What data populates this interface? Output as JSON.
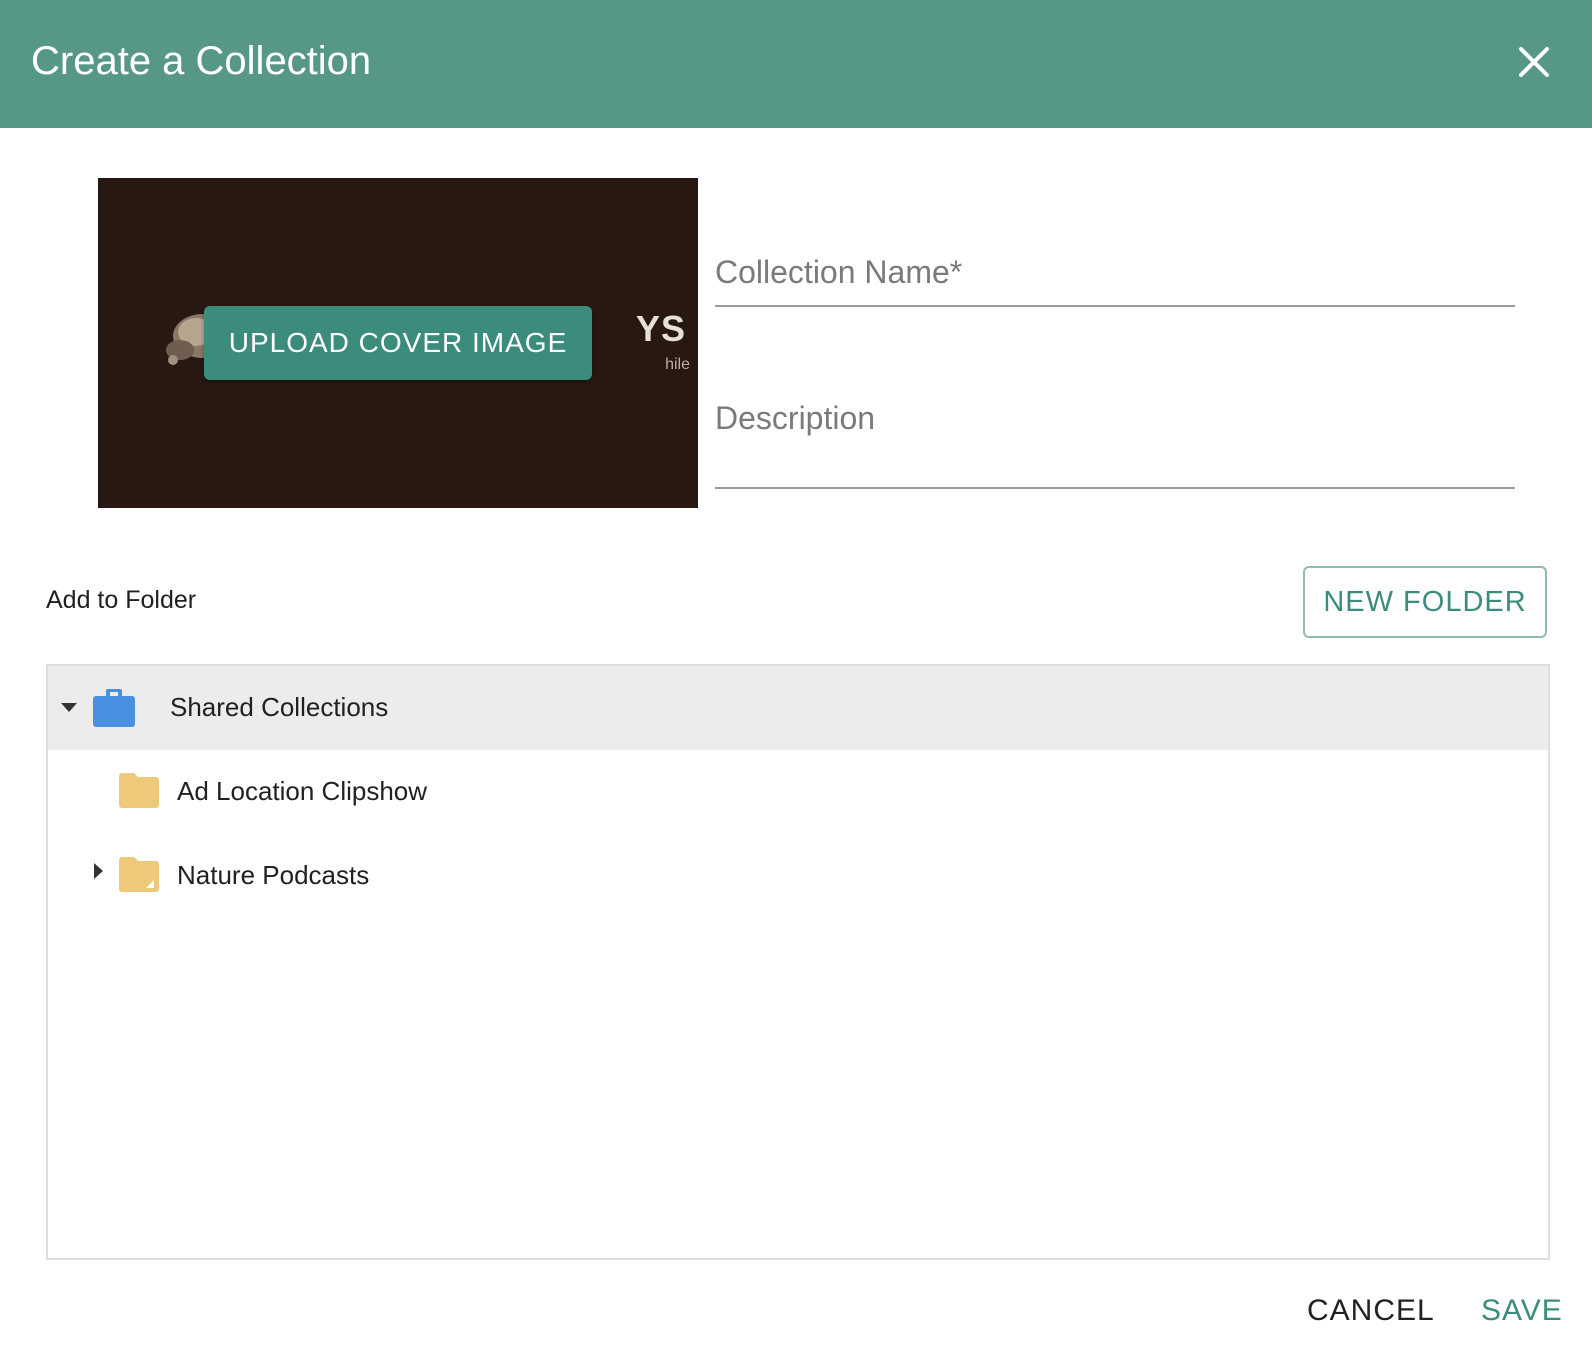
{
  "dialog": {
    "title": "Create a Collection",
    "close_icon": "close-icon"
  },
  "cover": {
    "upload_label": "UPLOAD COVER IMAGE",
    "logo_text": "YS",
    "logo_subtext": "hile"
  },
  "form": {
    "name_placeholder": "Collection Name*",
    "description_placeholder": "Description"
  },
  "folder": {
    "label": "Add to Folder",
    "new_folder_label": "NEW FOLDER"
  },
  "tree": {
    "root": {
      "label": "Shared Collections",
      "icon": "briefcase-icon",
      "expanded": true
    },
    "children": [
      {
        "label": "Ad Location Clipshow",
        "icon": "folder-icon",
        "has_children": false
      },
      {
        "label": "Nature Podcasts",
        "icon": "shared-folder-icon",
        "has_children": true
      }
    ]
  },
  "actions": {
    "cancel_label": "CANCEL",
    "save_label": "SAVE"
  },
  "colors": {
    "header": "#579788",
    "accent": "#3c8c7e",
    "folder": "#efc97a",
    "briefcase": "#4a90e2",
    "cover_bg": "#281812"
  }
}
